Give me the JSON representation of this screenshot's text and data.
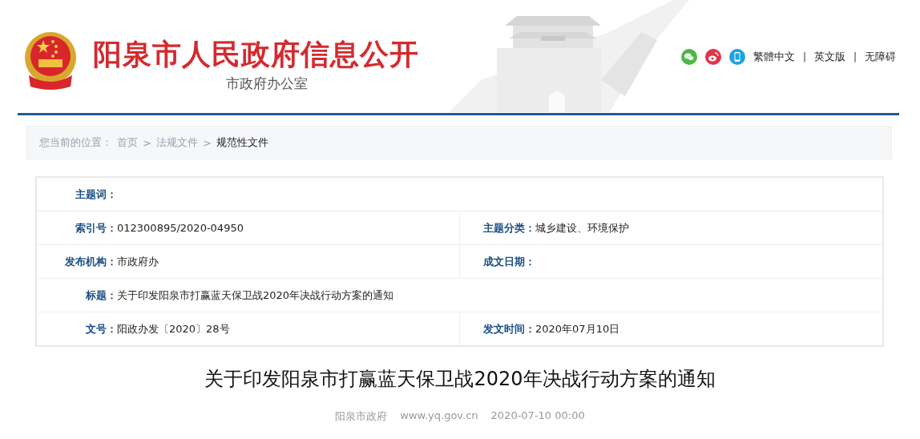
{
  "header": {
    "title": "阳泉市人民政府信息公开",
    "subtitle": "市政府办公室",
    "links": [
      {
        "kind": "wechat"
      },
      {
        "kind": "weibo"
      },
      {
        "kind": "mobile"
      },
      {
        "kind": "text",
        "text": "繁體中文"
      },
      {
        "kind": "text",
        "text": "英文版"
      },
      {
        "kind": "text",
        "text": "无障碍"
      }
    ],
    "separator": "|"
  },
  "breadcrumb": {
    "label": "您当前的位置：",
    "items": [
      {
        "text": "首页",
        "current": false
      },
      {
        "text": "法规文件",
        "current": false
      },
      {
        "text": "规范性文件",
        "current": true
      }
    ],
    "separator": ">"
  },
  "info_table": {
    "rows": [
      [
        {
          "label": "主题词："
        }
      ],
      [
        {
          "label": "索引号：",
          "value": "012300895/2020-04950"
        },
        {
          "label": "主题分类：",
          "value": "城乡建设、环境保护"
        }
      ],
      [
        {
          "label": "发布机构：",
          "value": "市政府办"
        },
        {
          "label": "成文日期："
        }
      ],
      [
        {
          "label": "标题：",
          "value": "关于印发阳泉市打赢蓝天保卫战2020年决战行动方案的通知"
        }
      ],
      [
        {
          "label": "文号：",
          "value": "阳政办发〔2020〕28号"
        },
        {
          "label": "发文时间：",
          "value": "2020年07月10日"
        }
      ]
    ]
  },
  "article": {
    "title": "关于印发阳泉市打赢蓝天保卫战2020年决战行动方案的通知",
    "meta": [
      "阳泉市政府",
      "www.yq.gov.cn",
      "2020-07-10 00:00"
    ]
  }
}
